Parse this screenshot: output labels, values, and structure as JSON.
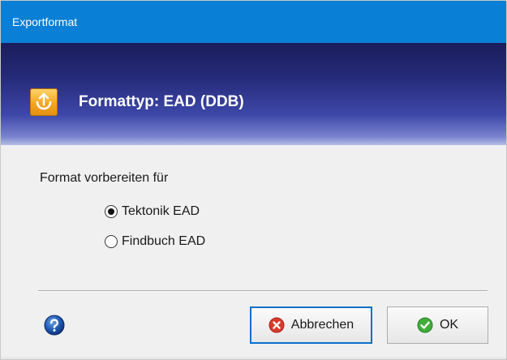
{
  "window": {
    "title": "Exportformat"
  },
  "header": {
    "icon": "export-upload-icon",
    "title": "Formattyp: EAD (DDB)"
  },
  "content": {
    "label": "Format vorbereiten für",
    "options": [
      {
        "label": "Tektonik EAD",
        "selected": true
      },
      {
        "label": "Findbuch EAD",
        "selected": false
      }
    ]
  },
  "footer": {
    "help_icon": "help-icon",
    "cancel_label": "Abbrechen",
    "ok_label": "OK"
  },
  "colors": {
    "titlebar": "#0a7fd6",
    "header_dark": "#1b1d5c",
    "header_light": "#b7bde6",
    "focus_border": "#0a6fcc"
  }
}
